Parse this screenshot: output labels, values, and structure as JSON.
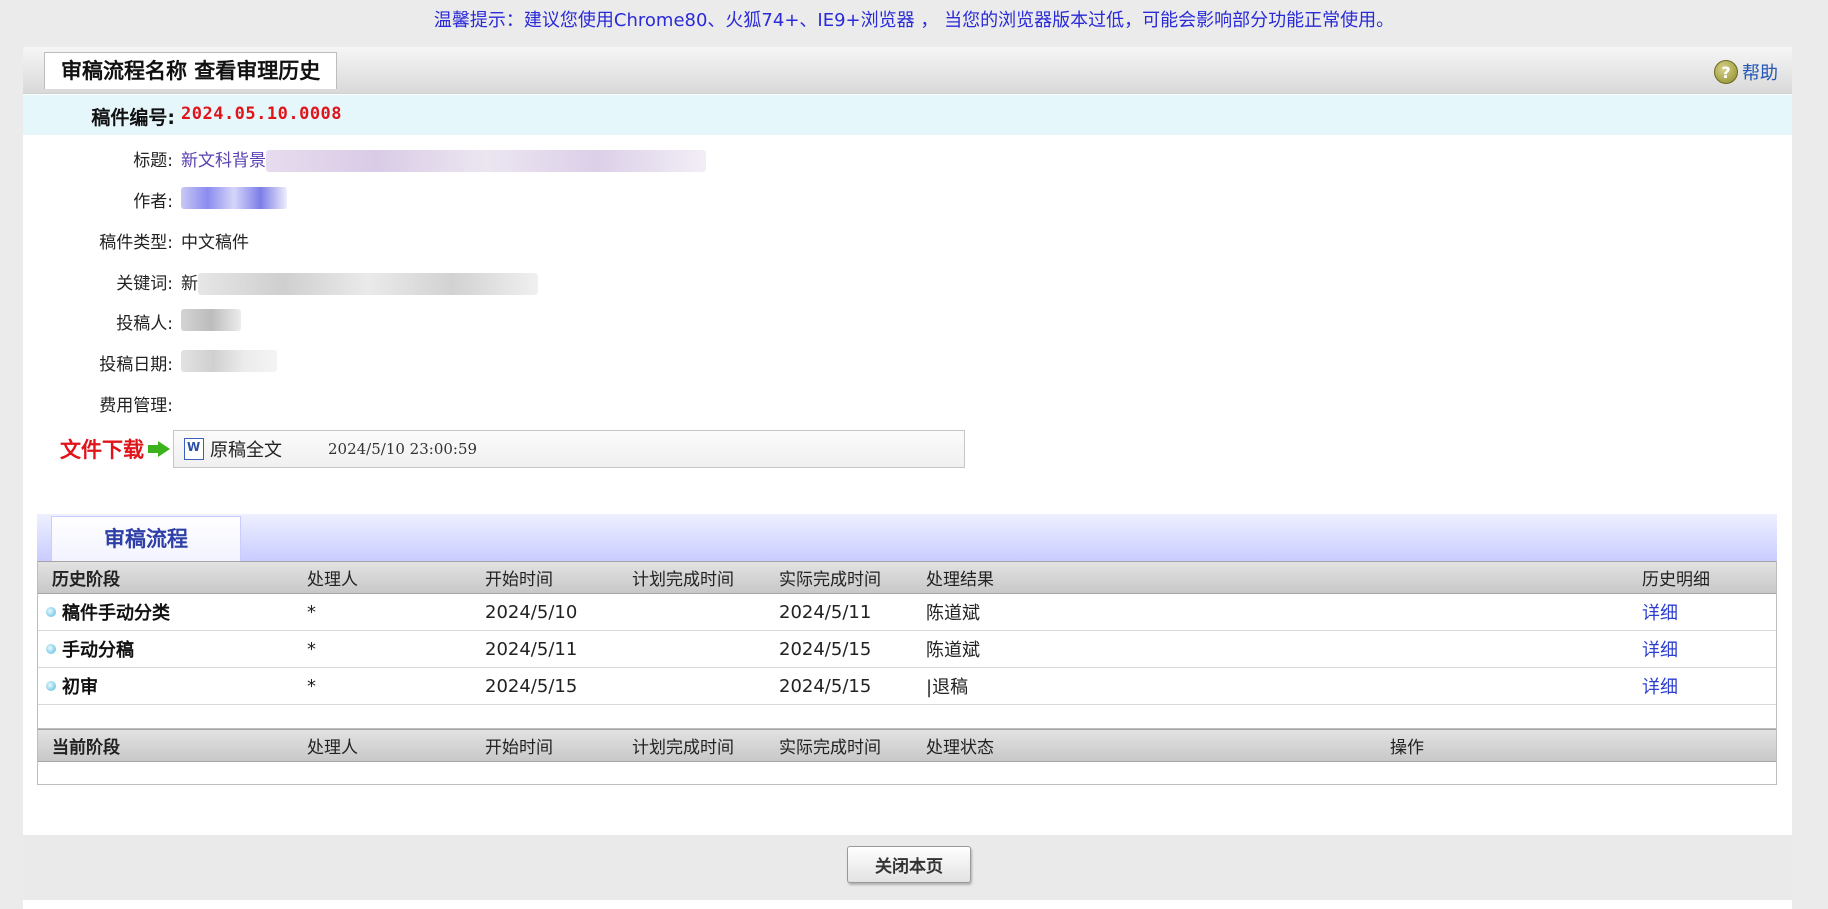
{
  "notice": "温馨提示：建议您使用Chrome80、火狐74+、IE9+浏览器 ， 当您的浏览器版本过低，可能会影响部分功能正常使用。",
  "header": {
    "title": "审稿流程名称 查看审理历史",
    "help_label": "帮助"
  },
  "manuscript": {
    "code_label": "稿件编号:",
    "code_value": "2024.05.10.0008",
    "fields": [
      {
        "label": "标题:",
        "value": "新文科背景"
      },
      {
        "label": "作者:",
        "value": ""
      },
      {
        "label": "稿件类型:",
        "value": "中文稿件"
      },
      {
        "label": "关键词:",
        "value": "新"
      },
      {
        "label": "投稿人:",
        "value": ""
      },
      {
        "label": "投稿日期:",
        "value": ""
      },
      {
        "label": "费用管理:",
        "value": ""
      }
    ]
  },
  "download": {
    "label": "文件下载",
    "file_name": "原稿全文",
    "file_time": "2024/5/10 23:00:59"
  },
  "flow": {
    "tab_label": "审稿流程",
    "history_headers": [
      "历史阶段",
      "处理人",
      "开始时间",
      "计划完成时间",
      "实际完成时间",
      "处理结果",
      "历史明细"
    ],
    "history_rows": [
      {
        "stage": "稿件手动分类",
        "handler": "*",
        "start": "2024/5/10",
        "planned": "",
        "actual": "2024/5/11",
        "result": "陈道斌",
        "detail": "详细"
      },
      {
        "stage": "手动分稿",
        "handler": "*",
        "start": "2024/5/11",
        "planned": "",
        "actual": "2024/5/15",
        "result": "陈道斌",
        "detail": "详细"
      },
      {
        "stage": "初审",
        "handler": "*",
        "start": "2024/5/15",
        "planned": "",
        "actual": "2024/5/15",
        "result": "|退稿",
        "detail": "详细"
      }
    ],
    "current_headers": [
      "当前阶段",
      "处理人",
      "开始时间",
      "计划完成时间",
      "实际完成时间",
      "处理状态",
      "操作"
    ]
  },
  "footer": {
    "close_label": "关闭本页"
  }
}
